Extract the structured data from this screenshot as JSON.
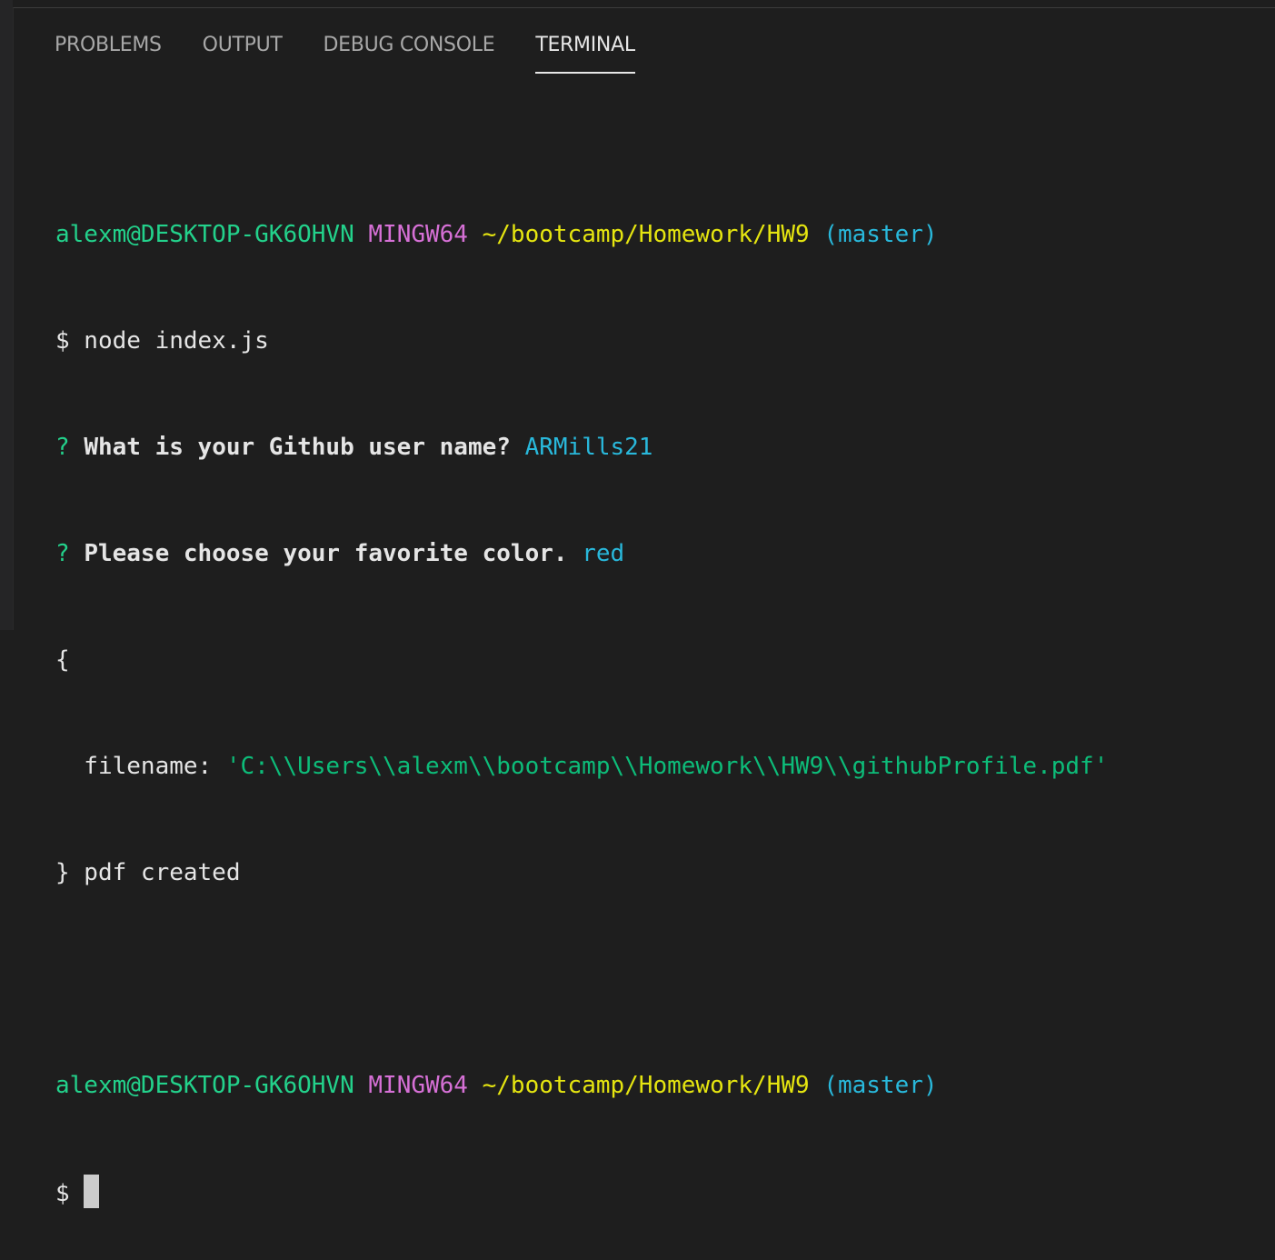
{
  "tabs": [
    {
      "label": "PROBLEMS",
      "active": false
    },
    {
      "label": "OUTPUT",
      "active": false
    },
    {
      "label": "DEBUG CONSOLE",
      "active": false
    },
    {
      "label": "TERMINAL",
      "active": true
    }
  ],
  "terminal": {
    "prompt1": {
      "user_host": "alexm@DESKTOP-GK6OHVN",
      "shell": "MINGW64",
      "path": "~/bootcamp/Homework/HW9",
      "branch": "(master)"
    },
    "command": "$ node index.js",
    "q1": {
      "mark": "?",
      "question": "What is your Github user name?",
      "answer": "ARMills21"
    },
    "q2": {
      "mark": "?",
      "question": "Please choose your favorite color.",
      "answer": "red"
    },
    "open_brace": "{",
    "filename_key": "  filename: ",
    "filename_value": "'C:\\\\Users\\\\alexm\\\\bootcamp\\\\Homework\\\\HW9\\\\githubProfile.pdf'",
    "close_line": "} pdf created",
    "prompt2": {
      "user_host": "alexm@DESKTOP-GK6OHVN",
      "shell": "MINGW64",
      "path": "~/bootcamp/Homework/HW9",
      "branch": "(master)"
    },
    "dollar": "$"
  },
  "colors": {
    "background": "#1e1e1e",
    "user_host": "#23d18b",
    "shell": "#d670d6",
    "path": "#e5e510",
    "branch": "#29b8db"
  }
}
